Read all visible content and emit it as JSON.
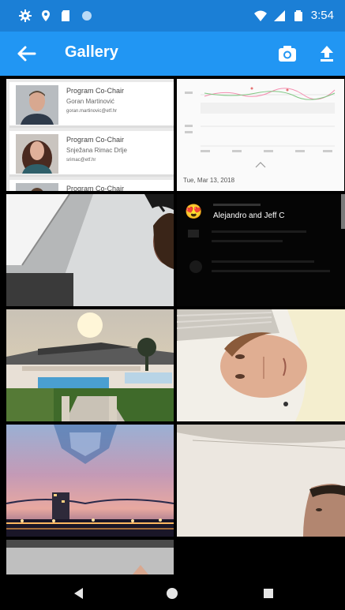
{
  "status_bar": {
    "time": "3:54",
    "icons": [
      "gear-icon",
      "location-icon",
      "sd-card-icon",
      "circle-icon",
      "wifi-icon",
      "signal-icon",
      "battery-icon"
    ]
  },
  "app_bar": {
    "title": "Gallery",
    "color": "#2196f3",
    "actions": [
      "back-arrow-icon",
      "camera-icon",
      "upload-icon"
    ]
  },
  "gallery": {
    "contacts": [
      {
        "role": "Program Co-Chair",
        "name": "Goran Martinović",
        "email": "goran.martinovic@etf.hr"
      },
      {
        "role": "Program Co-Chair",
        "name": "Snježana Rimac Drlje",
        "email": "srimac@etf.hr"
      },
      {
        "role": "Program Co-Chair",
        "name": "",
        "email": ""
      }
    ],
    "chart_date": "Tue, Mar 13, 2018",
    "notification": {
      "emoji": "😍",
      "text": "Alejandro and Jeff C"
    }
  },
  "nav_bar": {
    "buttons": [
      "back-triangle-icon",
      "home-circle-icon",
      "recents-square-icon"
    ]
  }
}
